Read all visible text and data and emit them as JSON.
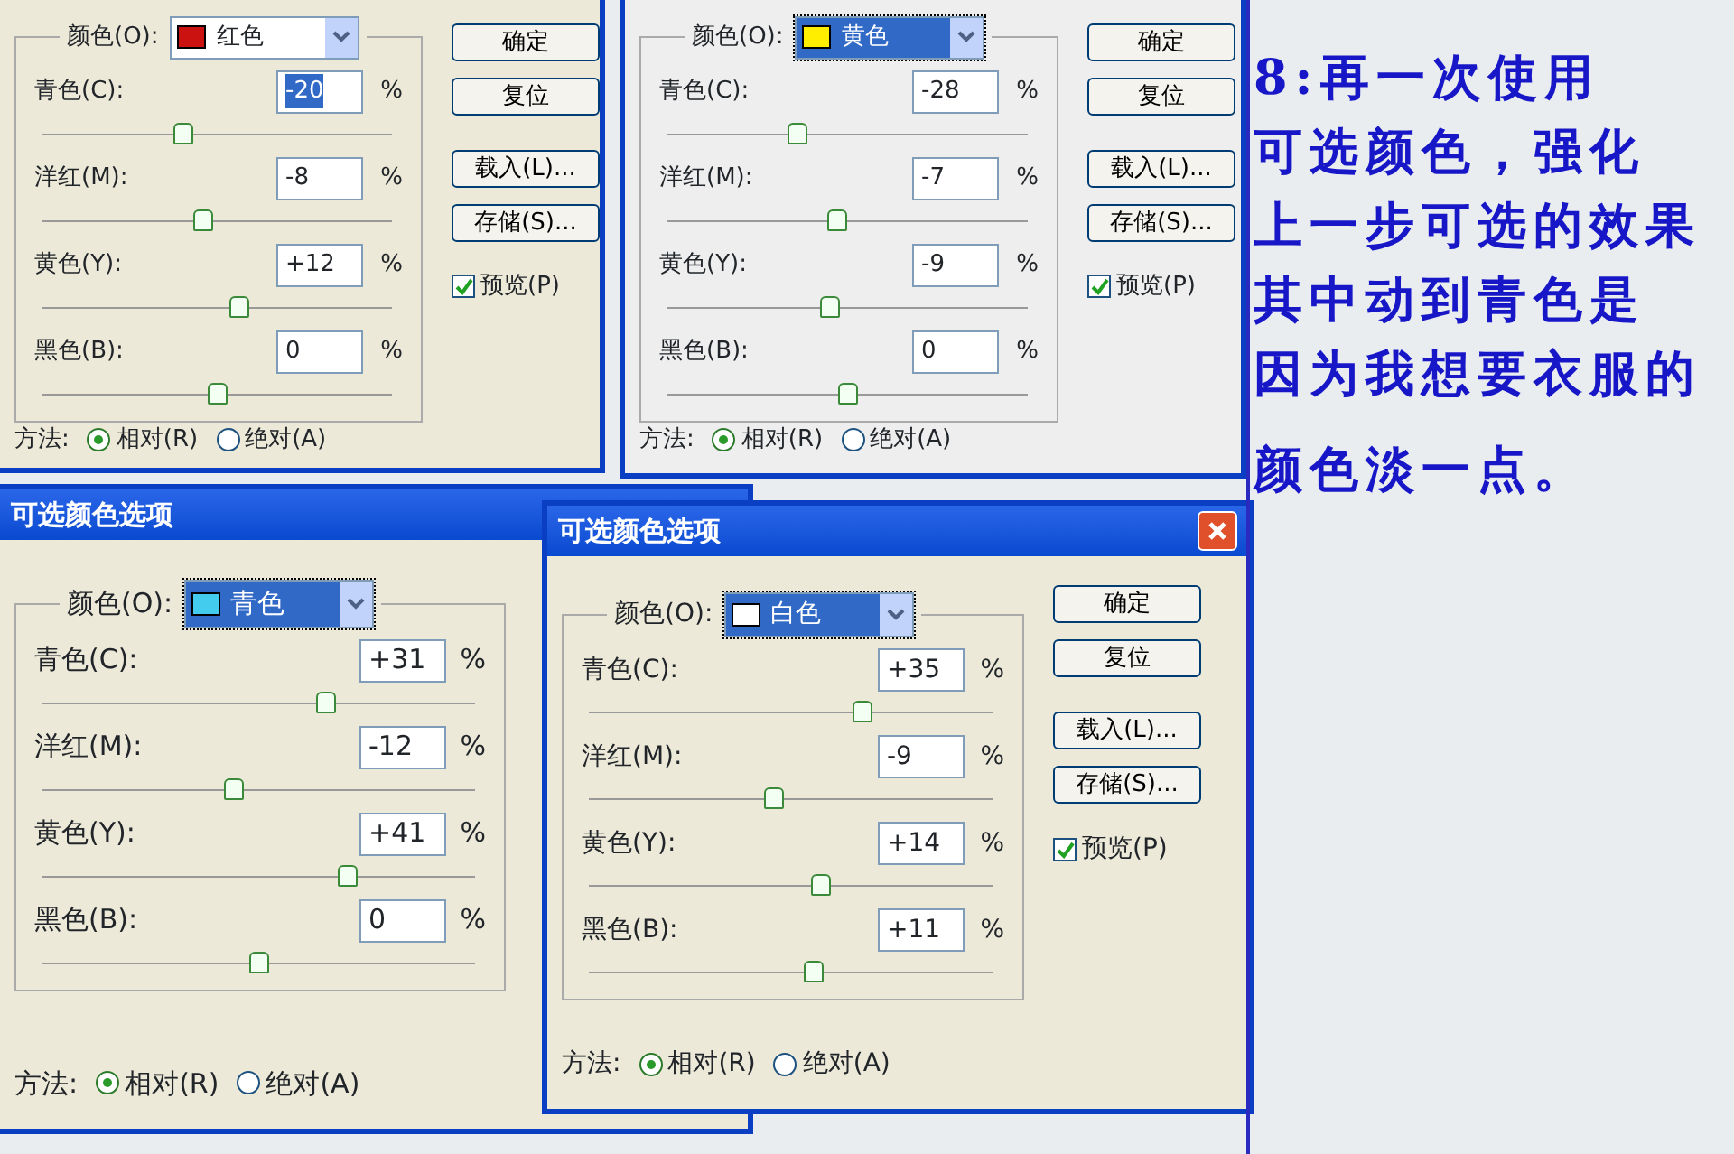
{
  "dialogs": [
    {
      "color": {
        "label": "颜色(O):",
        "value": "红色",
        "color": "#cc1111",
        "focused": false
      },
      "sliders": [
        {
          "label": "青色(C):",
          "value": "-20",
          "unit": "%",
          "level": 0.4,
          "selected": true
        },
        {
          "label": "洋红(M):",
          "value": "-8",
          "unit": "%",
          "level": 0.46,
          "selected": false
        },
        {
          "label": "黄色(Y):",
          "value": "+12",
          "unit": "%",
          "level": 0.56,
          "selected": false
        },
        {
          "label": "黑色(B):",
          "value": "0",
          "unit": "%",
          "level": 0.5,
          "selected": false
        }
      ],
      "buttons": [
        "确定",
        "复位",
        "载入(L)...",
        "存储(S)..."
      ],
      "preview": {
        "label": "预览(P)",
        "checked": true
      },
      "method": {
        "label": "方法:",
        "options": [
          {
            "label": "相对(R)",
            "selected": true
          },
          {
            "label": "绝对(A)",
            "selected": false
          }
        ]
      }
    },
    {
      "color": {
        "label": "颜色(O):",
        "value": "黄色",
        "color": "#ffee00",
        "focused": true
      },
      "sliders": [
        {
          "label": "青色(C):",
          "value": "-28",
          "unit": "%",
          "level": 0.36,
          "selected": false
        },
        {
          "label": "洋红(M):",
          "value": "-7",
          "unit": "%",
          "level": 0.47,
          "selected": false
        },
        {
          "label": "黄色(Y):",
          "value": "-9",
          "unit": "%",
          "level": 0.45,
          "selected": false
        },
        {
          "label": "黑色(B):",
          "value": "0",
          "unit": "%",
          "level": 0.5,
          "selected": false
        }
      ],
      "buttons": [
        "确定",
        "复位",
        "载入(L)...",
        "存储(S)..."
      ],
      "preview": {
        "label": "预览(P)",
        "checked": true
      },
      "method": {
        "label": "方法:",
        "options": [
          {
            "label": "相对(R)",
            "selected": true
          },
          {
            "label": "绝对(A)",
            "selected": false
          }
        ]
      }
    },
    {
      "title": "可选颜色选项",
      "close_button": false,
      "color": {
        "label": "颜色(O):",
        "value": "青色",
        "color": "#44ccee",
        "focused": true
      },
      "sliders": [
        {
          "label": "青色(C):",
          "value": "+31",
          "unit": "%",
          "level": 0.655,
          "selected": false
        },
        {
          "label": "洋红(M):",
          "value": "-12",
          "unit": "%",
          "level": 0.44,
          "selected": false
        },
        {
          "label": "黄色(Y):",
          "value": "+41",
          "unit": "%",
          "level": 0.705,
          "selected": false
        },
        {
          "label": "黑色(B):",
          "value": "0",
          "unit": "%",
          "level": 0.5,
          "selected": false
        }
      ],
      "method": {
        "label": "方法:",
        "options": [
          {
            "label": "相对(R)",
            "selected": true
          },
          {
            "label": "绝对(A)",
            "selected": false
          }
        ]
      }
    },
    {
      "title": "可选颜色选项",
      "close_button": true,
      "color": {
        "label": "颜色(O):",
        "value": "白色",
        "color": "#ffffff",
        "focused": true
      },
      "sliders": [
        {
          "label": "青色(C):",
          "value": "+35",
          "unit": "%",
          "level": 0.675,
          "selected": false
        },
        {
          "label": "洋红(M):",
          "value": "-9",
          "unit": "%",
          "level": 0.455,
          "selected": false
        },
        {
          "label": "黄色(Y):",
          "value": "+14",
          "unit": "%",
          "level": 0.57,
          "selected": false
        },
        {
          "label": "黑色(B):",
          "value": "+11",
          "unit": "%",
          "level": 0.555,
          "selected": false
        }
      ],
      "buttons": [
        "确定",
        "复位",
        "载入(L)...",
        "存储(S)..."
      ],
      "preview": {
        "label": "预览(P)",
        "checked": true
      },
      "method": {
        "label": "方法:",
        "options": [
          {
            "label": "相对(R)",
            "selected": true
          },
          {
            "label": "绝对(A)",
            "selected": false
          }
        ]
      }
    }
  ],
  "note": [
    "8:再一次使用",
    "可选颜色，强化",
    "上一步可选的效果",
    "其中动到青色是",
    "因为我想要衣服的",
    "颜色淡一点。"
  ]
}
